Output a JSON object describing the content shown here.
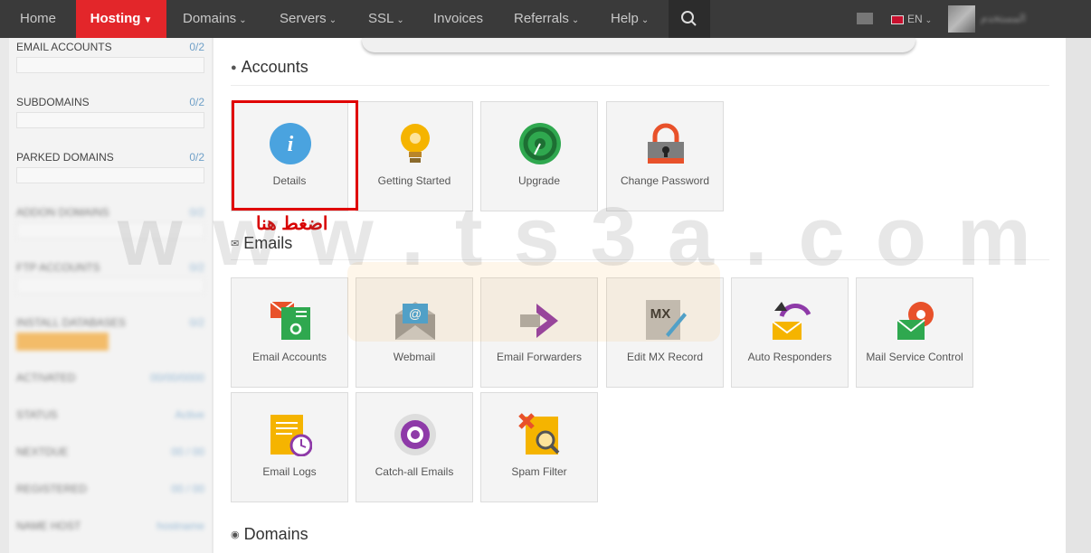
{
  "nav": {
    "items": [
      {
        "label": "Home"
      },
      {
        "label": "Hosting"
      },
      {
        "label": "Domains"
      },
      {
        "label": "Servers"
      },
      {
        "label": "SSL"
      },
      {
        "label": "Invoices"
      },
      {
        "label": "Referrals"
      },
      {
        "label": "Help"
      }
    ],
    "lang": "EN",
    "user_name": "المستخدم",
    "accent": "#e3262a"
  },
  "sidebar": {
    "rows": [
      {
        "label": "EMAIL ACCOUNTS",
        "count": "0/2"
      },
      {
        "label": "SUBDOMAINS",
        "count": "0/2"
      },
      {
        "label": "PARKED DOMAINS",
        "count": "0/2"
      },
      {
        "label": "ADDON DOMAINS",
        "count": "0/2"
      },
      {
        "label": "FTP ACCOUNTS",
        "count": "0/2"
      },
      {
        "label": "INSTALL DATABASES",
        "count": "0/2"
      },
      {
        "label": "ACTIVATED",
        "count": "00/00/0000"
      },
      {
        "label": "STATUS",
        "count": "Active"
      },
      {
        "label": "NEXTDUE",
        "count": "00 / 00"
      },
      {
        "label": "REGISTERED",
        "count": "00 / 00"
      },
      {
        "label": "NAME HOST",
        "count": "hostname"
      }
    ]
  },
  "sections": {
    "accounts": "Accounts",
    "emails": "Emails",
    "domains": "Domains"
  },
  "tiles": {
    "accounts": [
      {
        "label": "Details",
        "icon": "info-icon"
      },
      {
        "label": "Getting Started",
        "icon": "lightbulb-icon"
      },
      {
        "label": "Upgrade",
        "icon": "speedometer-icon"
      },
      {
        "label": "Change Password",
        "icon": "lock-icon"
      }
    ],
    "emails": [
      {
        "label": "Email Accounts",
        "icon": "email-accounts-icon"
      },
      {
        "label": "Webmail",
        "icon": "webmail-icon"
      },
      {
        "label": "Email Forwarders",
        "icon": "forward-arrow-icon"
      },
      {
        "label": "Edit MX Record",
        "icon": "mx-record-icon"
      },
      {
        "label": "Auto Responders",
        "icon": "auto-responder-icon"
      },
      {
        "label": "Mail Service Control",
        "icon": "mail-gear-icon"
      },
      {
        "label": "Email Logs",
        "icon": "email-logs-icon"
      },
      {
        "label": "Catch-all Emails",
        "icon": "catch-all-icon"
      },
      {
        "label": "Spam Filter",
        "icon": "spam-filter-icon"
      }
    ]
  },
  "annotation": {
    "text": "اضغط هنا",
    "color": "#e00000"
  },
  "watermark": "www.ts3a.com",
  "icons": {
    "mx_text": "MX",
    "webmail_at": "@",
    "details_i": "i"
  }
}
